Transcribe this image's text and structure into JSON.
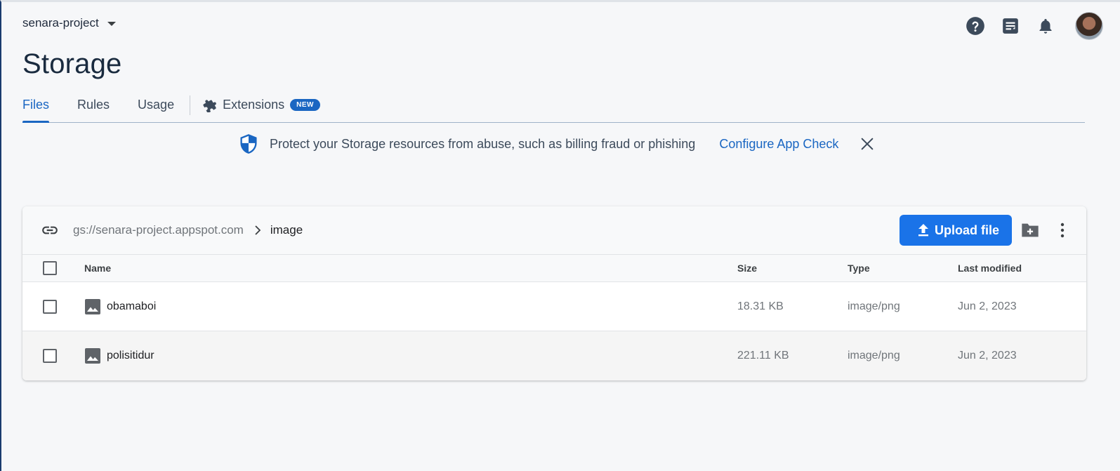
{
  "header": {
    "project_name": "senara-project",
    "icons": [
      "help-icon",
      "release-notes-icon",
      "notifications-icon",
      "account-avatar"
    ]
  },
  "page": {
    "title": "Storage"
  },
  "tabs": [
    {
      "label": "Files",
      "active": true
    },
    {
      "label": "Rules",
      "active": false
    },
    {
      "label": "Usage",
      "active": false
    },
    {
      "label": "Extensions",
      "badge": "NEW",
      "active": false
    }
  ],
  "banner": {
    "icon": "shield-icon",
    "message": "Protect your Storage resources from abuse, such as billing fraud or phishing",
    "link": "Configure App Check"
  },
  "browser": {
    "bucket": "gs://senara-project.appspot.com",
    "folder": "image",
    "upload_label": "Upload file",
    "columns": {
      "name": "Name",
      "size": "Size",
      "type": "Type",
      "modified": "Last modified"
    },
    "files": [
      {
        "name": "obamaboi",
        "size": "18.31 KB",
        "type": "image/png",
        "modified": "Jun 2, 2023"
      },
      {
        "name": "polisitidur",
        "size": "221.11 KB",
        "type": "image/png",
        "modified": "Jun 2, 2023"
      }
    ]
  },
  "colors": {
    "accent": "#1a73e8",
    "link": "#1a66c2",
    "title": "#1a2b3f"
  }
}
